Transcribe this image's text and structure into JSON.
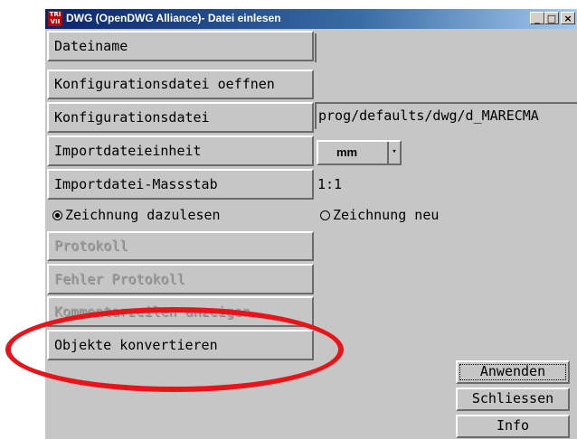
{
  "window": {
    "title": "DWG (OpenDWG Alliance)- Datei einlesen",
    "icon_text_top": "TRI",
    "icon_text_bottom": "VII",
    "controls": {
      "minimize": "_",
      "maximize": "□",
      "close": "×"
    }
  },
  "buttons": {
    "dateiname": "Dateiname",
    "konfig_oeffnen": "Konfigurationsdatei oeffnen",
    "konfig": "Konfigurationsdatei",
    "importeinheit": "Importdateieinheit",
    "massstab": "Importdatei-Massstab",
    "protokoll": "Protokoll",
    "fehler_protokoll": "Fehler Protokoll",
    "kommentarzeilen": "Kommentarzeilen anzeigen",
    "objekte": "Objekte konvertieren",
    "anwenden": "Anwenden",
    "schliessen": "Schliessen",
    "info": "Info"
  },
  "fields": {
    "dateiname_value": "",
    "konfig_value": "prog/defaults/dwg/d_MARECMA",
    "massstab_value": "1:1"
  },
  "unit_select": {
    "selected": "mm",
    "arrow": "▾"
  },
  "radios": {
    "dazulesen": {
      "label": "Zeichnung dazulesen",
      "checked": true
    },
    "neu": {
      "label": "Zeichnung neu",
      "checked": false
    }
  },
  "colors": {
    "dialog_bg": "#c6c6c6",
    "titlebar": "#0a246a",
    "highlight_annotation": "#e8141a"
  }
}
